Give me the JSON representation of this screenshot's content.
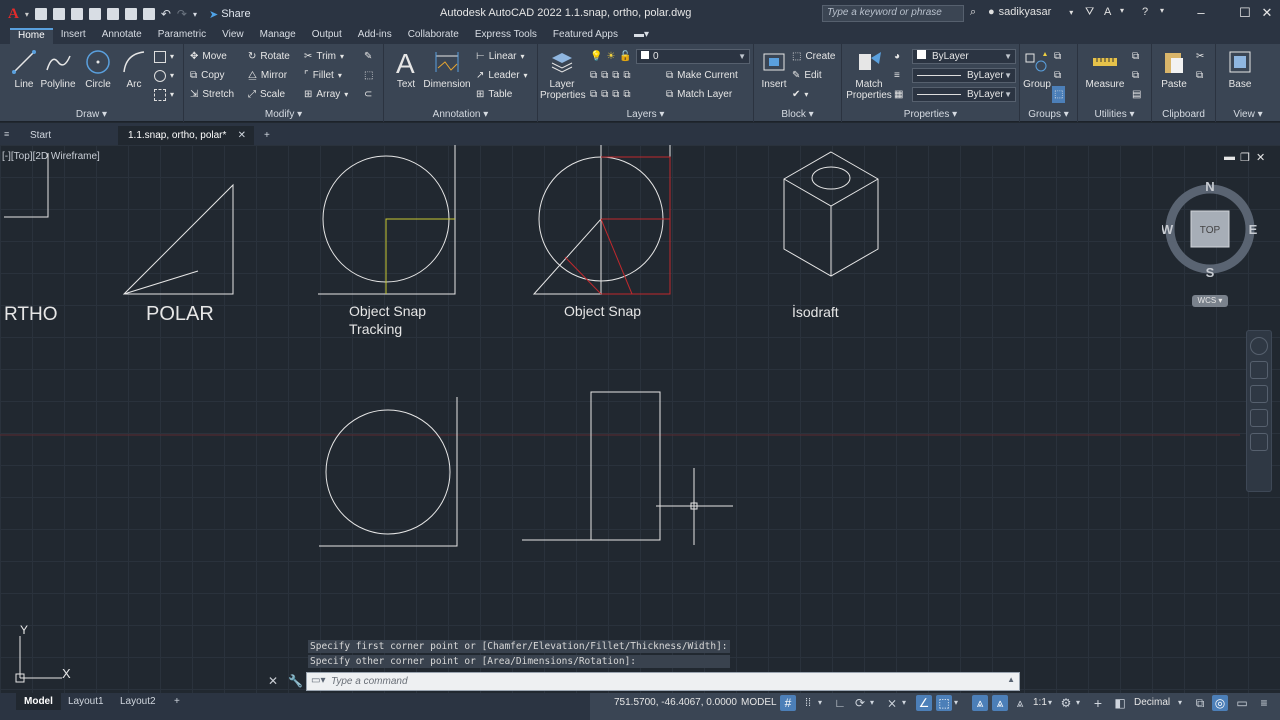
{
  "app": {
    "title": "Autodesk AutoCAD 2022    1.1.snap, ortho, polar.dwg",
    "share_label": "Share",
    "search_placeholder": "Type a keyword or phrase",
    "user": "sadikyasar"
  },
  "ribbon_tabs": [
    "Home",
    "Insert",
    "Annotate",
    "Parametric",
    "View",
    "Manage",
    "Output",
    "Add-ins",
    "Collaborate",
    "Express Tools",
    "Featured Apps"
  ],
  "active_tab": "Home",
  "ribbon": {
    "draw": {
      "title": "Draw",
      "line": "Line",
      "polyline": "Polyline",
      "circle": "Circle",
      "arc": "Arc"
    },
    "modify": {
      "title": "Modify",
      "move": "Move",
      "rotate": "Rotate",
      "trim": "Trim",
      "copy": "Copy",
      "mirror": "Mirror",
      "fillet": "Fillet",
      "stretch": "Stretch",
      "scale": "Scale",
      "array": "Array"
    },
    "annotation": {
      "title": "Annotation",
      "text": "Text",
      "dimension": "Dimension",
      "linear": "Linear",
      "leader": "Leader",
      "table": "Table"
    },
    "layers": {
      "title": "Layers",
      "layer_properties": "Layer Properties",
      "layer_value": "0",
      "make_current": "Make Current",
      "match_layer": "Match Layer"
    },
    "block": {
      "title": "Block",
      "insert": "Insert",
      "create": "Create",
      "edit": "Edit"
    },
    "properties": {
      "title": "Properties",
      "match_properties": "Match Properties",
      "color": "ByLayer",
      "linetype": "ByLayer",
      "lineweight": "ByLayer"
    },
    "groups": {
      "title": "Groups",
      "group": "Group"
    },
    "utilities": {
      "title": "Utilities",
      "measure": "Measure"
    },
    "clipboard": {
      "title": "Clipboard",
      "paste": "Paste"
    },
    "view": {
      "title": "View",
      "base": "Base"
    }
  },
  "doc_tabs": {
    "start": "Start",
    "current": "1.1.snap, ortho, polar*"
  },
  "canvas": {
    "viewport_label": "[-][Top][2D Wireframe]",
    "labels": {
      "ortho": "RTHO",
      "polar": "POLAR",
      "otrack_1": "Object Snap",
      "otrack_2": "Tracking",
      "osnap": "Object Snap",
      "isodraft": "İsodraft"
    }
  },
  "viewcube": {
    "top": "TOP",
    "n": "N",
    "s": "S",
    "e": "E",
    "w": "W",
    "wcs": "WCS"
  },
  "command": {
    "history": [
      "Specify first corner point or [Chamfer/Elevation/Fillet/Thickness/Width]:",
      "Specify other corner point or [Area/Dimensions/Rotation]:"
    ],
    "placeholder": "Type a command"
  },
  "ucs": {
    "x": "X",
    "y": "Y"
  },
  "layout_tabs": [
    "Model",
    "Layout1",
    "Layout2"
  ],
  "status": {
    "coordinates": "751.5700, -46.4067, 0.0000",
    "space": "MODEL",
    "scale": "1:1",
    "units": "Decimal"
  },
  "colors": {
    "accent": "#4c7fb8",
    "red_guides": "#c0282d",
    "tracking": "#c8c832",
    "line": "#e6e6e6"
  }
}
